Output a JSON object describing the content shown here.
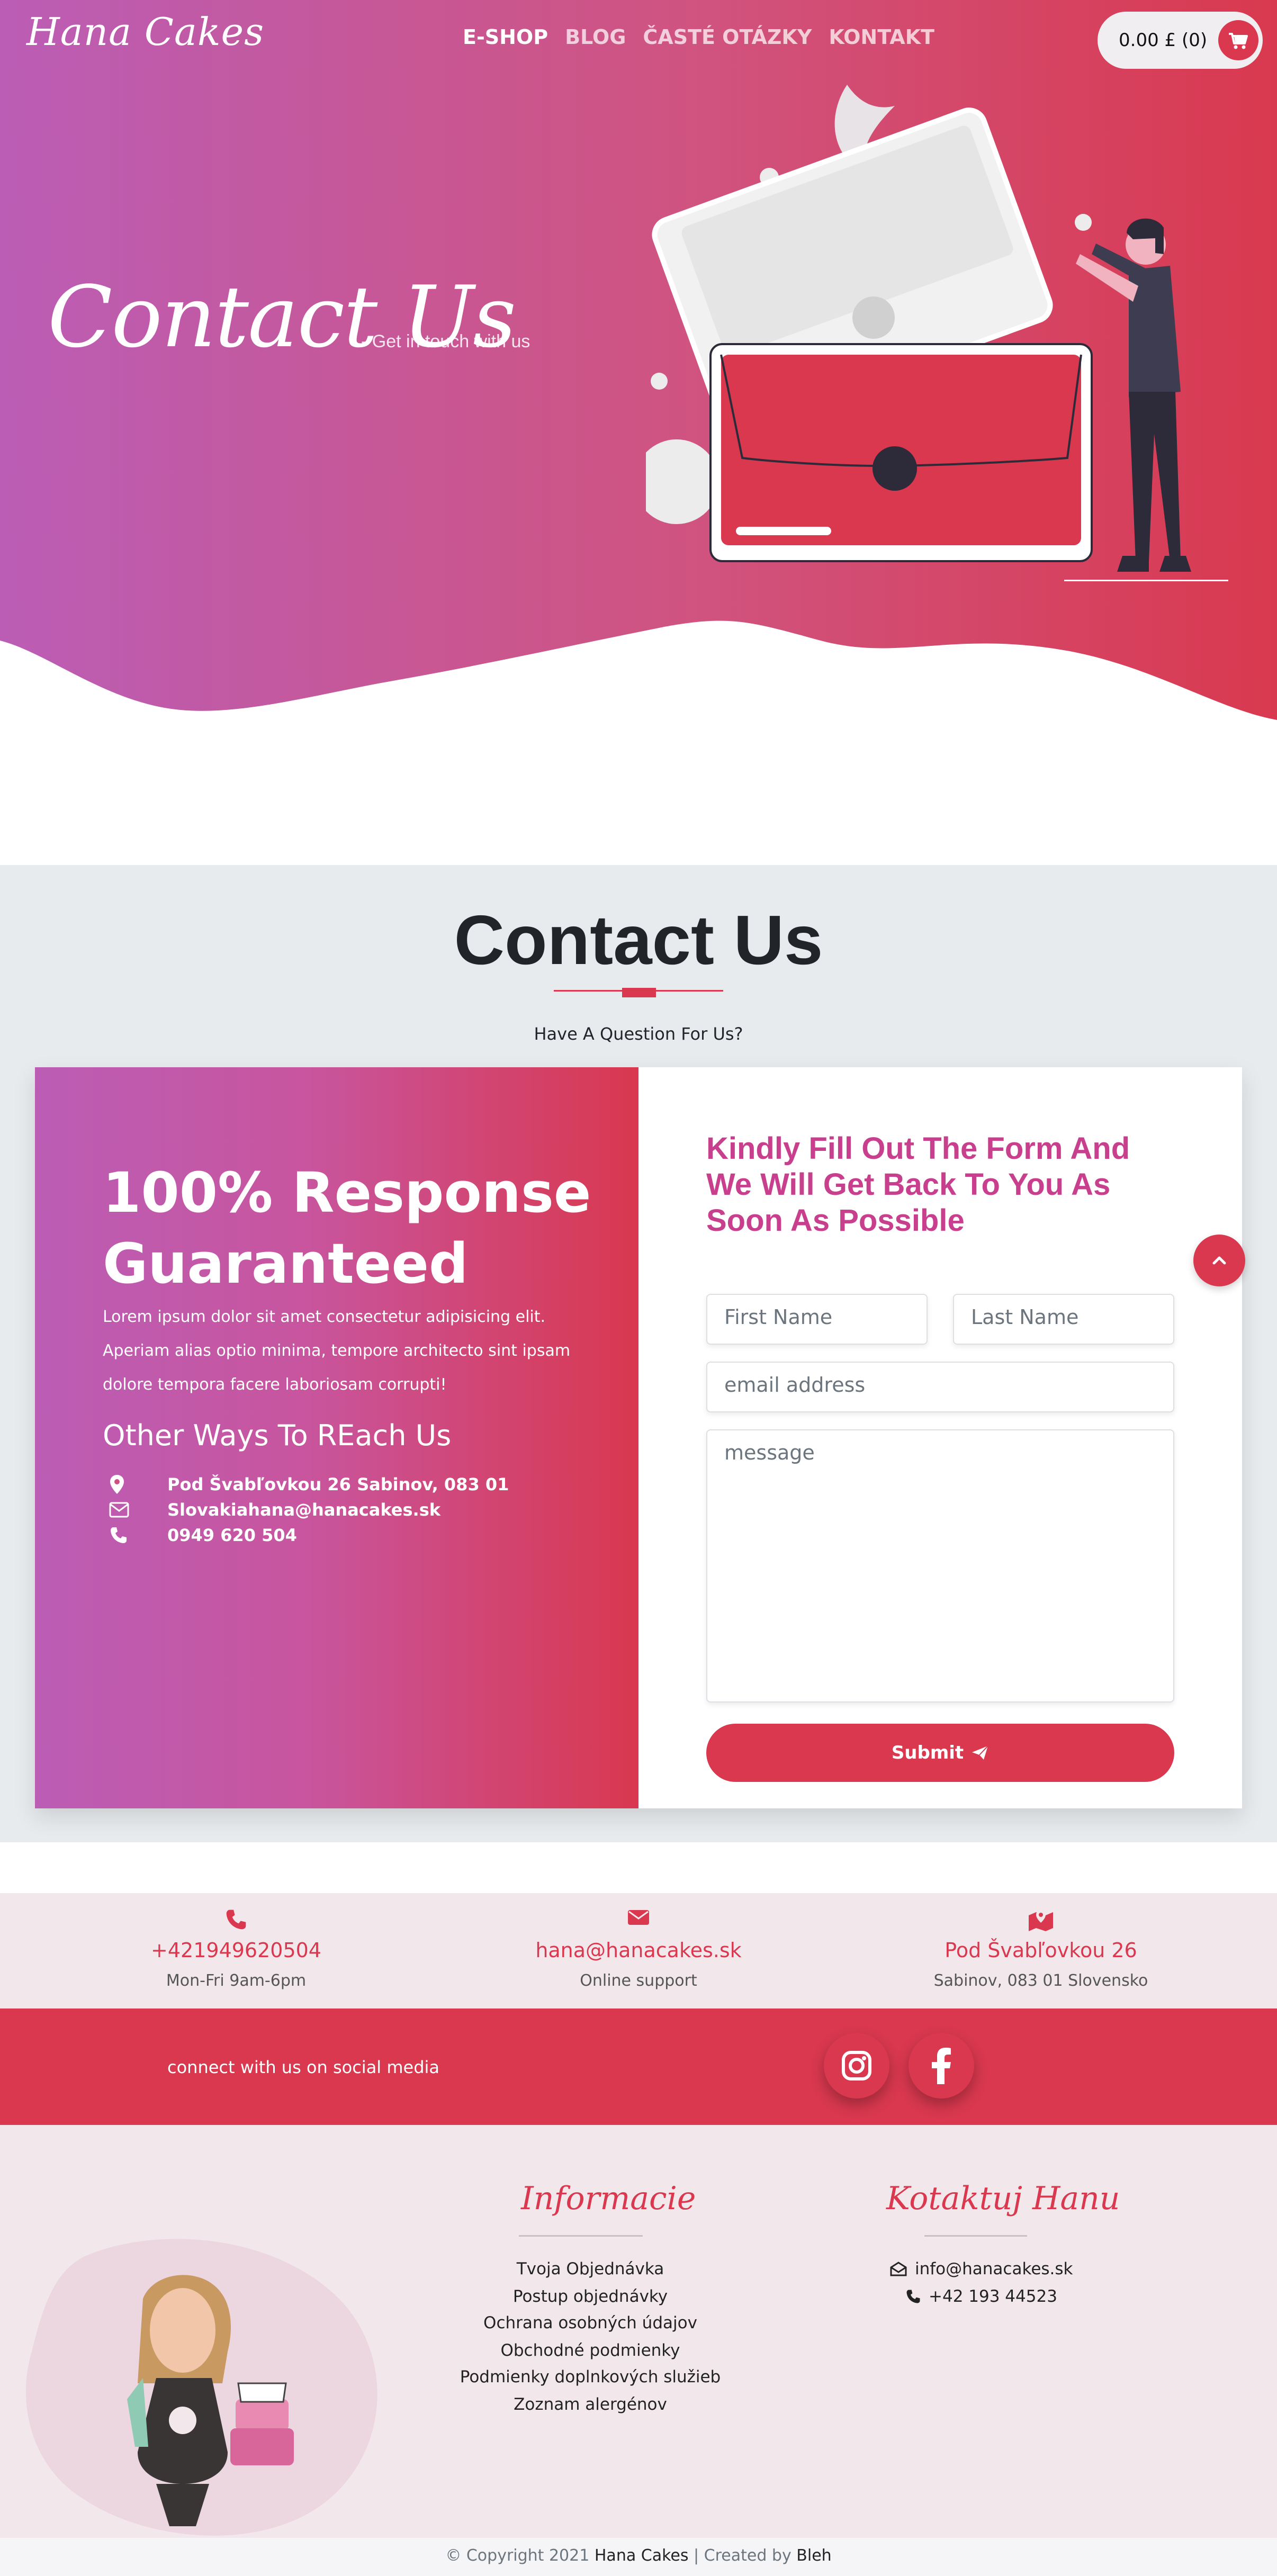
{
  "header": {
    "logo": "Hana Cakes",
    "nav": [
      "E-SHOP",
      "BLOG",
      "ČASTÉ OTÁZKY",
      "KONTAKT"
    ],
    "cart_label": "0.00 £ (0)"
  },
  "hero": {
    "title": "Contact Us",
    "subtitle": "- Get in touch with us"
  },
  "contact_section": {
    "title": "Contact Us",
    "subtitle": "Have A Question For Us?"
  },
  "left_panel": {
    "heading_line1": "100% Response",
    "heading_line2": "Guaranteed",
    "body": "Lorem ipsum dolor sit amet consectetur adipisicing elit. Aperiam alias optio minima, tempore architecto sint ipsam dolore tempora facere laboriosam corrupti!",
    "ways_title": "Other Ways To REach Us",
    "address": "Pod Švabľovkou 26 Sabinov, 083 01",
    "email": "Slovakiahana@hanacakes.sk",
    "phone": "0949 620 504"
  },
  "form": {
    "title": "Kindly Fill Out The Form And We Will Get Back To You As Soon As Possible",
    "first_name_placeholder": "First Name",
    "last_name_placeholder": "Last Name",
    "email_placeholder": "email address",
    "message_placeholder": "message",
    "submit_label": "Submit"
  },
  "info_strip": [
    {
      "main": "+421949620504",
      "sub": "Mon-Fri 9am-6pm",
      "icon": "phone-icon"
    },
    {
      "main": "hana@hanacakes.sk",
      "sub": "Online support",
      "icon": "envelope-icon"
    },
    {
      "main": "Pod Švabľovkou 26",
      "sub": "Sabinov, 083 01 Slovensko",
      "icon": "map-marker-icon"
    }
  ],
  "social": {
    "text": "connect with us on social media",
    "icons": [
      "instagram-icon",
      "facebook-icon"
    ]
  },
  "footer": {
    "info_title": "Informacie",
    "links": [
      "Tvoja Objednávka",
      "Postup objednávky",
      "Ochrana osobných údajov",
      "Obchodné podmienky",
      "Podmienky doplnkových služieb",
      "Zoznam alergénov"
    ],
    "contact_title": "Kotaktuj Hanu",
    "contact_email": "info@hanacakes.sk",
    "contact_phone": "+42 193 44523"
  },
  "copyright": {
    "prefix": "© Copyright 2021",
    "brand": "Hana Cakes",
    "separator": "| Created by",
    "author": "Bleh"
  },
  "colors": {
    "accent": "#d9384f",
    "gradient_start": "#bb5db5",
    "gradient_end": "#d9384f",
    "section_bg": "#e8ebee",
    "footer_bg": "#f2e8ec"
  }
}
